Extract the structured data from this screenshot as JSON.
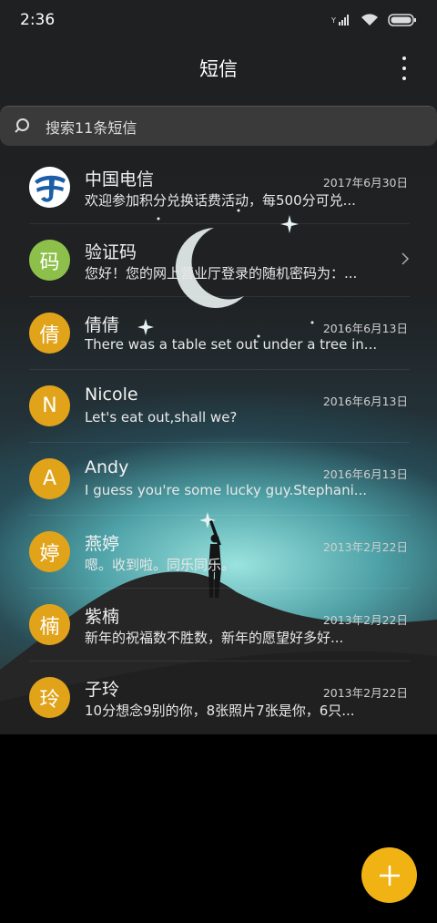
{
  "status_bar": {
    "time": "2:36"
  },
  "header": {
    "title": "短信"
  },
  "search": {
    "placeholder": "搜索11条短信"
  },
  "colors": {
    "accent": "#f1b314",
    "green_avatar": "#8cc04b",
    "orange_avatar": "#e0a31a",
    "telecom_blue": "#1d5ea8"
  },
  "conversations": [
    {
      "avatar_text": "",
      "avatar_icon": "china-telecom-logo",
      "name": "中国电信",
      "date": "2017年6月30日",
      "preview": "欢迎参加积分兑换话费活动，每500分可兑..."
    },
    {
      "avatar_text": "码",
      "name": "验证码",
      "date": "",
      "preview": "您好！您的网上营业厅登录的随机密码为：..."
    },
    {
      "avatar_text": "倩",
      "name": "倩倩",
      "date": "2016年6月13日",
      "preview": "There was a table set out under a tree in..."
    },
    {
      "avatar_text": "N",
      "name": "Nicole",
      "date": "2016年6月13日",
      "preview": "Let's eat out,shall we?"
    },
    {
      "avatar_text": "A",
      "name": "Andy",
      "date": "2016年6月13日",
      "preview": "I guess you're some lucky guy.Stephani..."
    },
    {
      "avatar_text": "婷",
      "name": "燕婷",
      "date": "2013年2月22日",
      "preview": "嗯。收到啦。同乐同乐。"
    },
    {
      "avatar_text": "楠",
      "name": "紫楠",
      "date": "2013年2月22日",
      "preview": "新年的祝福数不胜数，新年的愿望好多好..."
    },
    {
      "avatar_text": "玲",
      "name": "子玲",
      "date": "2013年2月22日",
      "preview": "10分想念9别的你，8张照片7张是你，6只..."
    }
  ]
}
